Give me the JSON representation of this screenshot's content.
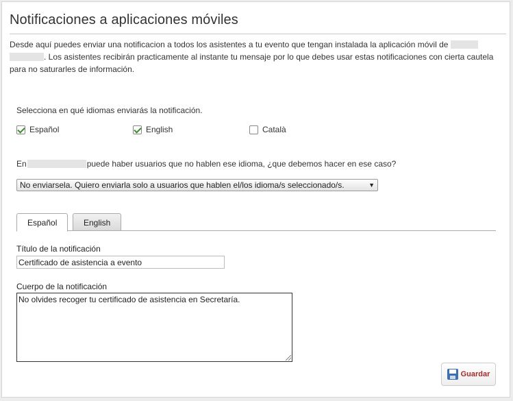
{
  "page": {
    "title": "Notificaciones a aplicaciones móviles",
    "intro_part1": "Desde aquí puedes enviar una notificacion a todos los asistentes a tu evento que tengan instalada la aplicación móvil de ",
    "intro_part2": ". Los asistentes recibirán practicamente al instante tu mensaje por lo que debes usar estas notificaciones con cierta cautela para no saturarles de información."
  },
  "languages": {
    "question": "Selecciona en qué idiomas enviarás la notificación.",
    "options": [
      {
        "label": "Español",
        "checked": true
      },
      {
        "label": "English",
        "checked": true
      },
      {
        "label": "Català",
        "checked": false
      }
    ]
  },
  "fallback": {
    "prefix": "En",
    "suffix": "puede haber usuarios que no hablen ese idioma, ¿que debemos hacer en ese caso?",
    "selected": "No enviarsela. Quiero enviarla solo a usuarios que hablen el/los idioma/s seleccionado/s."
  },
  "tabs": [
    {
      "label": "Español",
      "active": true
    },
    {
      "label": "English",
      "active": false
    }
  ],
  "form": {
    "title_label": "Título de la notificación",
    "title_value": "Certificado de asistencia a evento",
    "body_label": "Cuerpo de la notificación",
    "body_value": "No olvides recoger tu certificado de asistencia en Secretaría."
  },
  "actions": {
    "save_label": "Guardar",
    "save_icon": "floppy-disk-icon"
  },
  "colors": {
    "checkmark": "#3a8a2a",
    "save_text": "#a52a2a",
    "disk_icon": "#3d6fb3"
  }
}
